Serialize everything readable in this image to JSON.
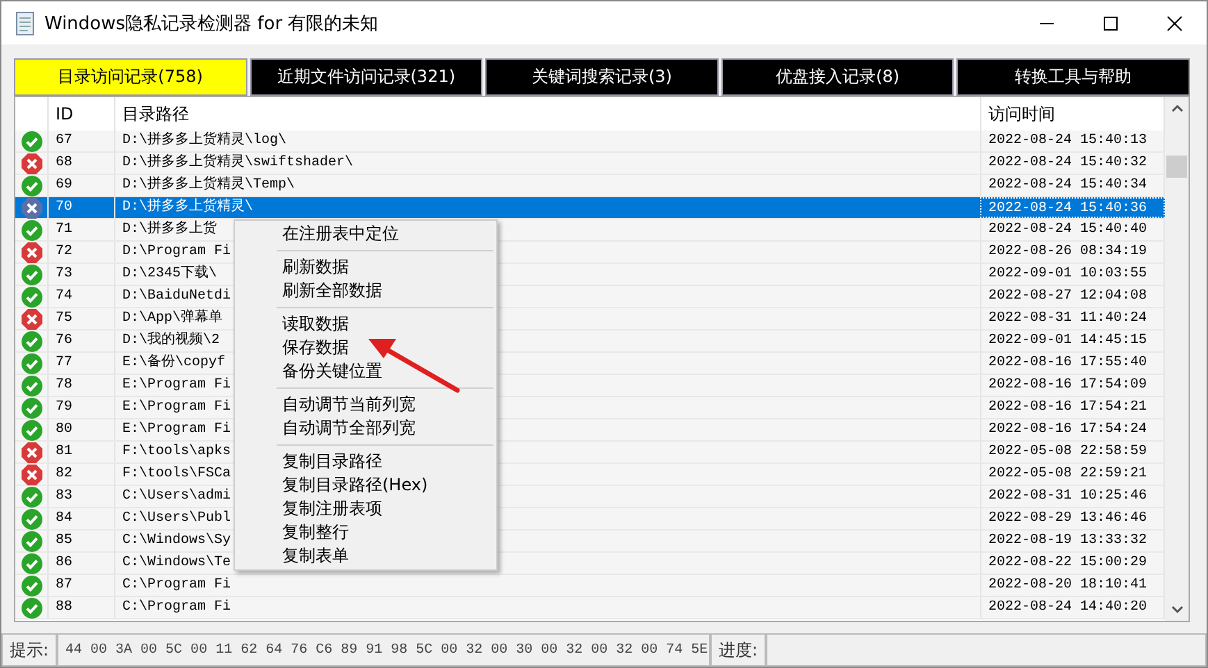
{
  "window": {
    "title": "Windows隐私记录检测器  for 有限的未知"
  },
  "tabs": [
    {
      "label": "目录访问记录(758)",
      "selected": true
    },
    {
      "label": "近期文件访问记录(321)",
      "selected": false
    },
    {
      "label": "关键词搜索记录(3)",
      "selected": false
    },
    {
      "label": "优盘接入记录(8)",
      "selected": false
    },
    {
      "label": "转换工具与帮助",
      "selected": false
    }
  ],
  "table": {
    "columns": [
      "ID",
      "目录路径",
      "访问时间"
    ],
    "rows": [
      {
        "kind": "ok",
        "id": "67",
        "path": "D:\\拼多多上货精灵\\log\\",
        "time": "2022-08-24 15:40:13",
        "selected": false
      },
      {
        "kind": "error",
        "id": "68",
        "path": "D:\\拼多多上货精灵\\swiftshader\\",
        "time": "2022-08-24 15:40:32",
        "selected": false
      },
      {
        "kind": "ok",
        "id": "69",
        "path": "D:\\拼多多上货精灵\\Temp\\",
        "time": "2022-08-24 15:40:34",
        "selected": false
      },
      {
        "kind": "error",
        "id": "70",
        "path": "D:\\拼多多上货精灵\\",
        "time": "2022-08-24 15:40:36",
        "selected": true
      },
      {
        "kind": "ok",
        "id": "71",
        "path": "D:\\拼多多上货",
        "time": "2022-08-24 15:40:40",
        "selected": false
      },
      {
        "kind": "error",
        "id": "72",
        "path": "D:\\Program Fi",
        "time": "2022-08-26 08:34:19",
        "selected": false
      },
      {
        "kind": "ok",
        "id": "73",
        "path": "D:\\2345下载\\",
        "time": "2022-09-01 10:03:55",
        "selected": false
      },
      {
        "kind": "ok",
        "id": "74",
        "path": "D:\\BaiduNetdi",
        "time": "2022-08-27 12:04:08",
        "selected": false
      },
      {
        "kind": "error",
        "id": "75",
        "path": "D:\\App\\弹幕单",
        "time": "2022-08-31 11:40:24",
        "selected": false
      },
      {
        "kind": "ok",
        "id": "76",
        "path": "D:\\我的视频\\2",
        "time": "2022-09-01 14:45:15",
        "selected": false
      },
      {
        "kind": "ok",
        "id": "77",
        "path": "E:\\备份\\copyf",
        "time": "2022-08-16 17:55:40",
        "selected": false
      },
      {
        "kind": "ok",
        "id": "78",
        "path": "E:\\Program Fi",
        "time": "2022-08-16 17:54:09",
        "selected": false
      },
      {
        "kind": "ok",
        "id": "79",
        "path": "E:\\Program Fi",
        "time": "2022-08-16 17:54:21",
        "selected": false
      },
      {
        "kind": "ok",
        "id": "80",
        "path": "E:\\Program Fi",
        "time": "2022-08-16 17:54:24",
        "selected": false
      },
      {
        "kind": "error",
        "id": "81",
        "path": "F:\\tools\\apks",
        "time": "2022-05-08 22:58:59",
        "selected": false
      },
      {
        "kind": "error",
        "id": "82",
        "path": "F:\\tools\\FSCa",
        "time": "2022-05-08 22:59:21",
        "selected": false
      },
      {
        "kind": "ok",
        "id": "83",
        "path": "C:\\Users\\admi",
        "time": "2022-08-31 10:25:46",
        "selected": false
      },
      {
        "kind": "ok",
        "id": "84",
        "path": "C:\\Users\\Publ",
        "time": "2022-08-29 13:46:46",
        "selected": false
      },
      {
        "kind": "ok",
        "id": "85",
        "path": "C:\\Windows\\Sy",
        "time": "2022-08-19 13:33:32",
        "selected": false
      },
      {
        "kind": "ok",
        "id": "86",
        "path": "C:\\Windows\\Te",
        "time": "2022-08-22 15:00:29",
        "selected": false
      },
      {
        "kind": "ok",
        "id": "87",
        "path": "C:\\Program Fi",
        "time": "2022-08-20 18:10:41",
        "selected": false
      },
      {
        "kind": "ok",
        "id": "88",
        "path": "C:\\Program Fi",
        "time": "2022-08-24 14:40:20",
        "selected": false
      }
    ]
  },
  "context_menu": {
    "groups": [
      [
        "在注册表中定位"
      ],
      [
        "刷新数据",
        "刷新全部数据"
      ],
      [
        "读取数据",
        "保存数据",
        "备份关键位置"
      ],
      [
        "自动调节当前列宽",
        "自动调节全部列宽"
      ],
      [
        "复制目录路径",
        "复制目录路径(Hex)",
        "复制注册表项",
        "复制整行",
        "复制表单"
      ]
    ]
  },
  "status_bar": {
    "hint_label": "提示:",
    "hint_value": "44 00 3A 00 5C 00 11 62 64 76 C6 89 91 98 5C 00 32 00 30 00 32 00 32 00 74 5E",
    "progress_label": "进度:"
  }
}
